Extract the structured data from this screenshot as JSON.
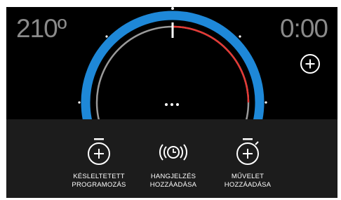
{
  "display": {
    "temperature": "210º",
    "timer": "0:00"
  },
  "dial": {
    "more": "..."
  },
  "actions": [
    {
      "line1": "KÉSLELTETETT",
      "line2": "PROGRAMOZÁS",
      "icon": "stopwatch-plus-icon"
    },
    {
      "line1": "HANGJELZÉS",
      "line2": "HOZZÁADÁSA",
      "icon": "alarm-sound-icon"
    },
    {
      "line1": "MŰVELET",
      "line2": "HOZZÁADÁSA",
      "icon": "timer-plus-icon"
    }
  ],
  "colors": {
    "ring": "#1e88d8",
    "progress": "#e53935",
    "track": "#9a9a9a",
    "panel": "#1c1c1c"
  }
}
